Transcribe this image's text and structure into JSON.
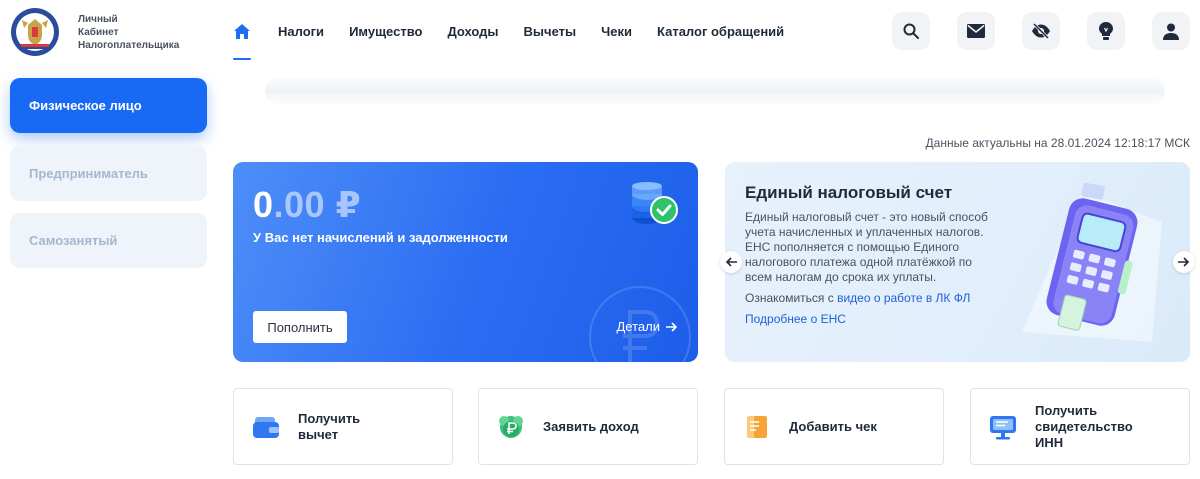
{
  "header": {
    "logo_line1": "Личный",
    "logo_line2": "Кабинет",
    "logo_line3": "Налогоплательщика",
    "nav": [
      "Налоги",
      "Имущество",
      "Доходы",
      "Вычеты",
      "Чеки",
      "Каталог обращений"
    ],
    "icons": [
      "search-icon",
      "mail-icon",
      "eye-off-icon",
      "lightbulb-icon",
      "user-icon"
    ]
  },
  "sidebar": {
    "items": [
      {
        "label": "Физическое лицо",
        "active": true
      },
      {
        "label": "Предприниматель",
        "active": false
      },
      {
        "label": "Самозанятый",
        "active": false
      }
    ]
  },
  "updated_text": "Данные актуальны на 28.01.2024 12:18:17 МСК",
  "balance": {
    "amount_int": "0",
    "amount_dec": ".00",
    "currency": "₽",
    "status": "У Вас нет начислений и задолженности",
    "pay_label": "Пополнить",
    "details_label": "Детали"
  },
  "ens": {
    "title": "Единый налоговый счет",
    "text": "Единый налоговый счет - это новый способ учета начисленных и уплаченных налогов. ЕНС пополняется с помощью Единого налогового платежа одной платёжкой по всем налогам до срока их уплаты.",
    "video_prefix": "Ознакомиться с ",
    "video_link": "видео о работе в ЛК ФЛ",
    "more_link": "Подробнее о ЕНС"
  },
  "tiles": [
    {
      "label": "Получить вычет"
    },
    {
      "label": "Заявить доход"
    },
    {
      "label": "Добавить чек"
    },
    {
      "label": "Получить свидетельство ИНН"
    }
  ],
  "colors": {
    "accent": "#1869f4",
    "link": "#1f62d6",
    "success": "#2dc26b"
  }
}
